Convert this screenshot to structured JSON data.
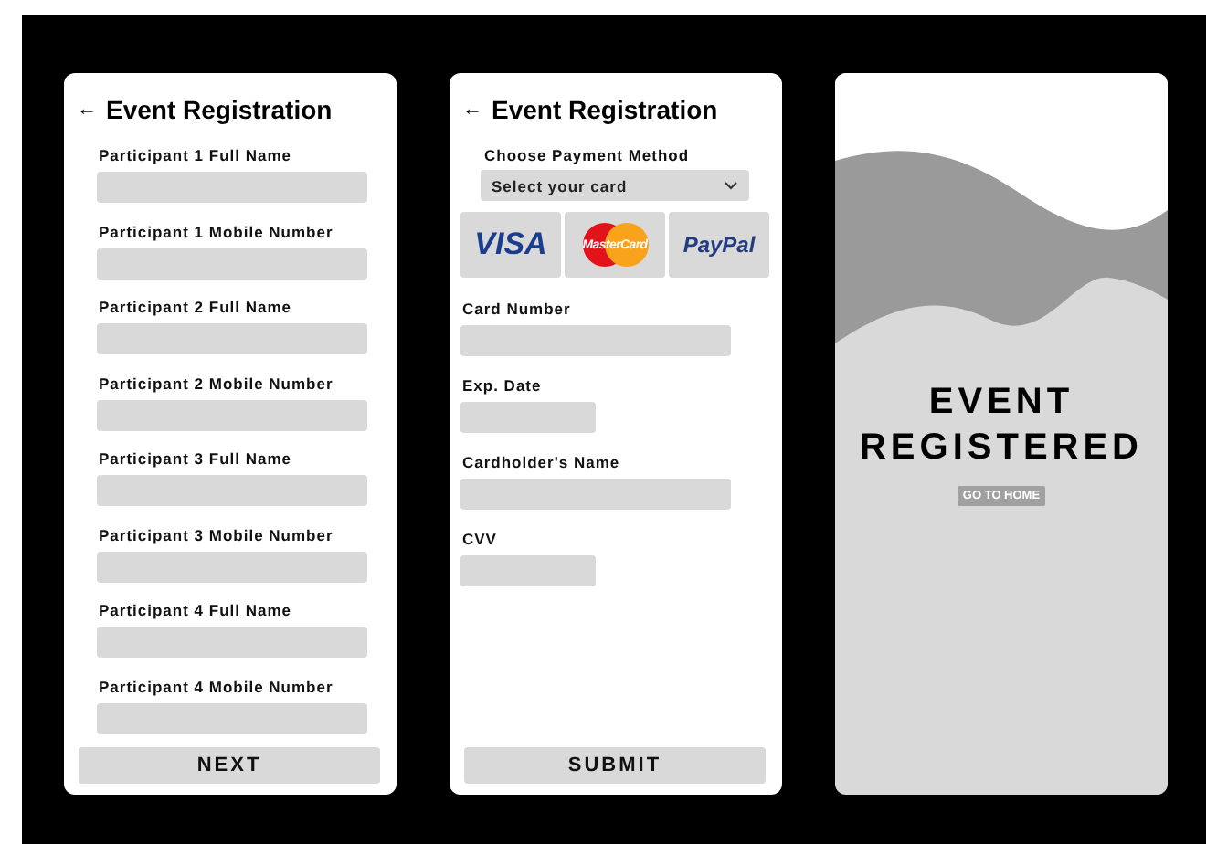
{
  "registration": {
    "title": "Event Registration",
    "back_icon": "←",
    "fields": [
      {
        "label": "Participant 1 Full Name"
      },
      {
        "label": "Participant 1 Mobile Number"
      },
      {
        "label": "Participant 2 Full Name"
      },
      {
        "label": "Participant 2 Mobile Number"
      },
      {
        "label": "Participant 3 Full Name"
      },
      {
        "label": "Participant 3 Mobile Number"
      },
      {
        "label": "Participant 4 Full Name"
      },
      {
        "label": "Participant 4 Mobile Number"
      }
    ],
    "button": "NEXT"
  },
  "payment": {
    "title": "Event Registration",
    "back_icon": "←",
    "method_label": "Choose Payment Method",
    "select_placeholder": "Select your card",
    "cards": [
      {
        "kind": "visa",
        "text": "VISA"
      },
      {
        "kind": "mastercard",
        "text": "MasterCard"
      },
      {
        "kind": "paypal",
        "text": "PayPal"
      }
    ],
    "fields": [
      {
        "label": "Card Number",
        "kind": "wide"
      },
      {
        "label": "Exp. Date",
        "kind": "short"
      },
      {
        "label": "Cardholder's Name",
        "kind": "wide"
      },
      {
        "label": "CVV",
        "kind": "short"
      }
    ],
    "button": "SUBMIT"
  },
  "confirmation": {
    "heading_lines": [
      "EVENT",
      "REGISTERED"
    ],
    "button": "GO TO HOME"
  }
}
